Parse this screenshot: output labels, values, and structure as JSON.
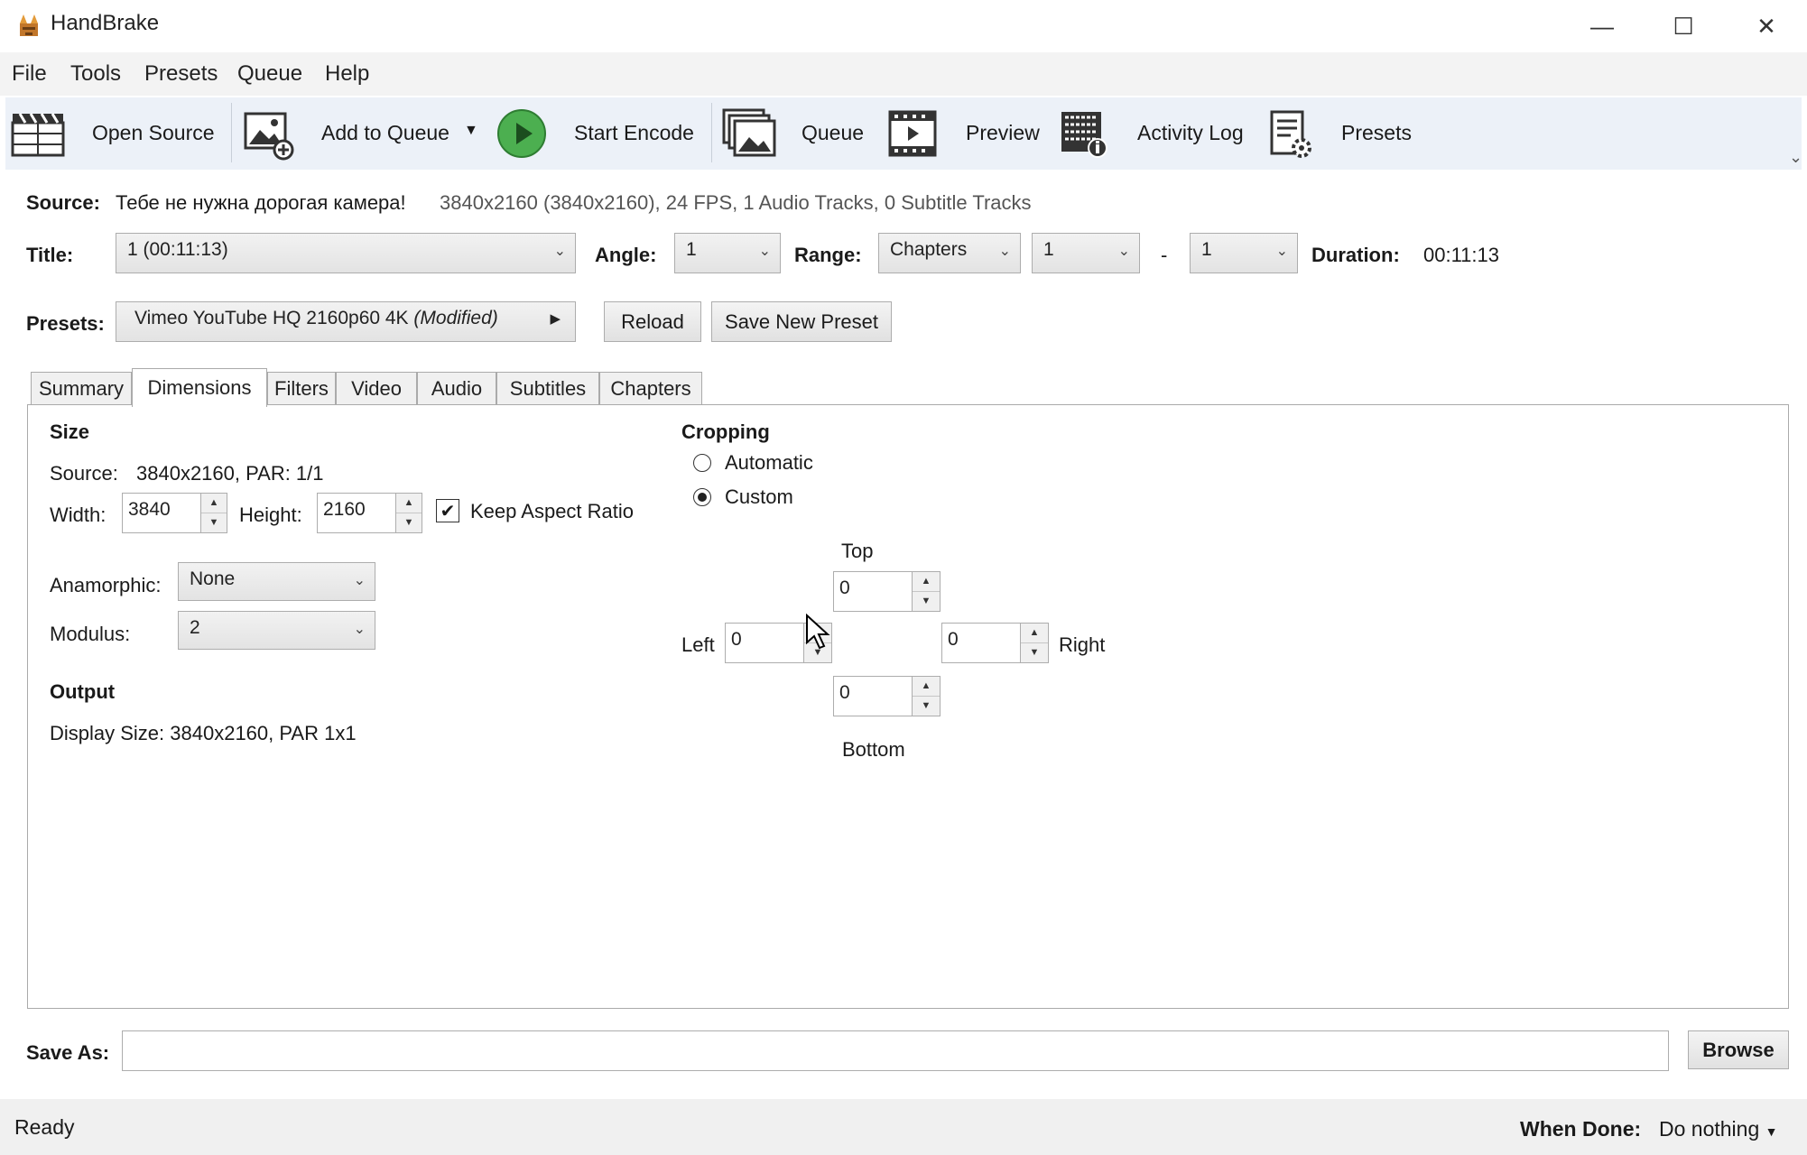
{
  "window": {
    "title": "HandBrake",
    "minimize": "—",
    "maximize": "☐",
    "close": "✕"
  },
  "menu": [
    "File",
    "Tools",
    "Presets",
    "Queue",
    "Help"
  ],
  "toolbar": {
    "open_source": "Open Source",
    "add_to_queue": "Add to Queue",
    "start_encode": "Start Encode",
    "queue": "Queue",
    "preview": "Preview",
    "activity_log": "Activity Log",
    "presets": "Presets",
    "overflow": "⌄"
  },
  "source": {
    "label": "Source:",
    "name": "Тебе не нужна дорогая камера!",
    "info": "3840x2160 (3840x2160), 24 FPS, 1 Audio Tracks, 0 Subtitle Tracks"
  },
  "title_row": {
    "title_label": "Title:",
    "title_value": "1 (00:11:13)",
    "angle_label": "Angle:",
    "angle_value": "1",
    "range_label": "Range:",
    "range_type": "Chapters",
    "range_start": "1",
    "range_dash": "-",
    "range_end": "1",
    "duration_label": "Duration:",
    "duration_value": "00:11:13"
  },
  "presets_row": {
    "label": "Presets:",
    "preset_name": "Vimeo YouTube HQ 2160p60 4K",
    "modified": "(Modified)",
    "reload": "Reload",
    "save_new": "Save New Preset"
  },
  "tabs": [
    "Summary",
    "Dimensions",
    "Filters",
    "Video",
    "Audio",
    "Subtitles",
    "Chapters"
  ],
  "dimensions": {
    "size_heading": "Size",
    "source_label": "Source:",
    "source_value": "3840x2160, PAR: 1/1",
    "width_label": "Width:",
    "width_value": "3840",
    "height_label": "Height:",
    "height_value": "2160",
    "keep_aspect": "Keep Aspect Ratio",
    "anamorphic_label": "Anamorphic:",
    "anamorphic_value": "None",
    "modulus_label": "Modulus:",
    "modulus_value": "2",
    "output_heading": "Output",
    "display_size": "Display Size: 3840x2160,  PAR 1x1"
  },
  "cropping": {
    "heading": "Cropping",
    "automatic": "Automatic",
    "custom": "Custom",
    "top_label": "Top",
    "top_value": "0",
    "left_label": "Left",
    "left_value": "0",
    "right_label": "Right",
    "right_value": "0",
    "bottom_label": "Bottom",
    "bottom_value": "0"
  },
  "save_as": {
    "label": "Save As:",
    "value": "",
    "browse": "Browse"
  },
  "status": {
    "text": "Ready",
    "when_done_label": "When Done:",
    "when_done_value": "Do nothing"
  },
  "colors": {
    "toolbar_bg": "#ecf1f8",
    "encode_green": "#4caf50",
    "statusbar_bg": "#f0f0f0"
  }
}
